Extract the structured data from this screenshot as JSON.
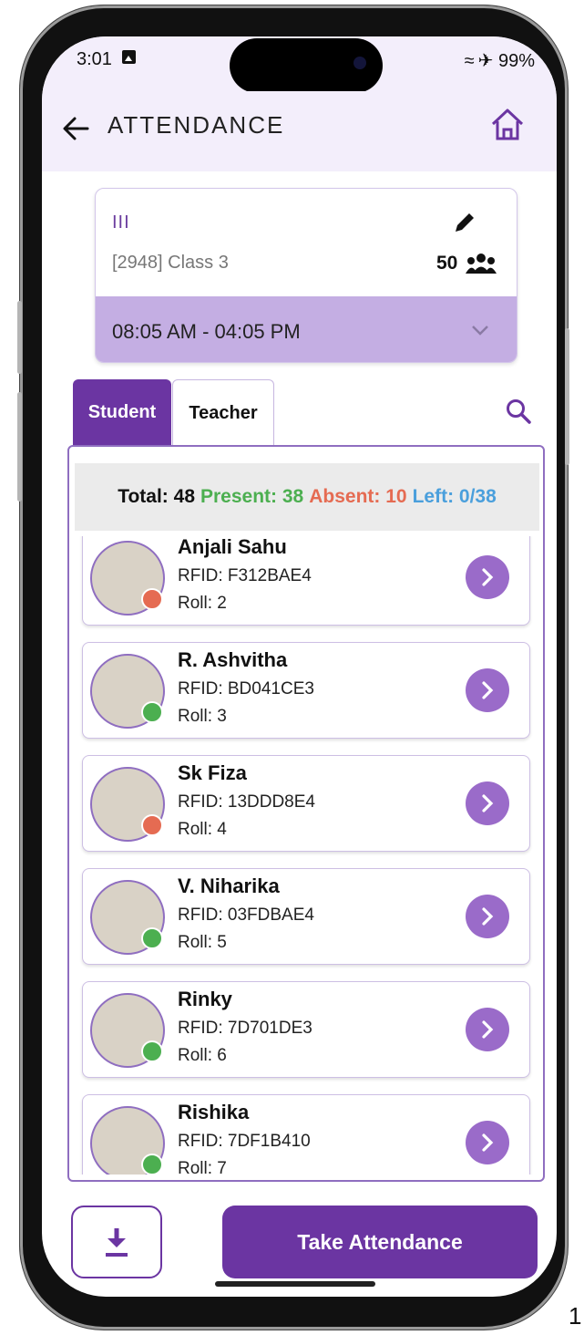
{
  "status_bar": {
    "time": "3:01",
    "right": " ✈ 99%"
  },
  "app_bar": {
    "title": "ATTENDANCE"
  },
  "class_card": {
    "roman": "III",
    "class_name": "[2948]  Class 3",
    "student_count": "50",
    "time_range": "08:05 AM - 04:05 PM"
  },
  "tabs": [
    {
      "label": "Student",
      "selected": true
    },
    {
      "label": "Teacher",
      "selected": false
    }
  ],
  "summary": {
    "total": "Total: 48",
    "present": "Present: 38",
    "absent": "Absent: 10",
    "left": "Left: 0/38"
  },
  "students": [
    {
      "name": "Anjali Sahu",
      "rfid": "RFID: F312BAE4",
      "roll": "Roll: 2",
      "status": "absent"
    },
    {
      "name": "R. Ashvitha",
      "rfid": "RFID: BD041CE3",
      "roll": "Roll: 3",
      "status": "present"
    },
    {
      "name": "Sk Fiza",
      "rfid": "RFID: 13DDD8E4",
      "roll": "Roll: 4",
      "status": "absent"
    },
    {
      "name": "V. Niharika",
      "rfid": "RFID: 03FDBAE4",
      "roll": "Roll: 5",
      "status": "present"
    },
    {
      "name": "Rinky",
      "rfid": "RFID: 7D701DE3",
      "roll": "Roll: 6",
      "status": "present"
    },
    {
      "name": "Rishika",
      "rfid": "RFID: 7DF1B410",
      "roll": "Roll: 7",
      "status": "present"
    }
  ],
  "actions": {
    "take_attendance": "Take Attendance"
  },
  "page_number": "1",
  "colors": {
    "primary": "#6b35a2",
    "present": "#4caf50",
    "absent": "#e56b52",
    "left": "#4a9fdc",
    "accent_light": "#c4aee3"
  }
}
